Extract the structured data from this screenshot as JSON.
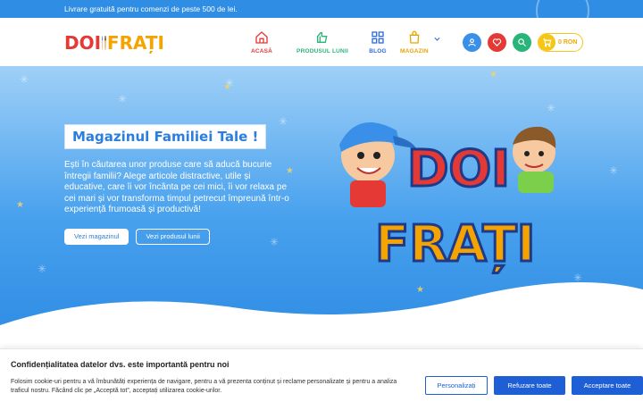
{
  "topbar": {
    "text": "Livrare gratuită pentru comenzi de peste 500 de lei."
  },
  "logo": {
    "text_part1": "DOI",
    "text_part2": "FRAȚI"
  },
  "nav": {
    "items": [
      {
        "label": "ACASĂ",
        "icon": "home-icon"
      },
      {
        "label": "PRODUSUL LUNII",
        "icon": "product-icon"
      },
      {
        "label": "BLOG",
        "icon": "grid-icon"
      },
      {
        "label": "MAGAZIN",
        "icon": "shopping-bag-icon"
      }
    ]
  },
  "header_actions": {
    "account_icon": "user-icon",
    "wishlist_icon": "heart-icon",
    "search_icon": "search-icon",
    "cart_icon": "cart-icon",
    "cart_total": "0 RON"
  },
  "hero": {
    "title": "Magazinul Familiei Tale !",
    "text": "Ești în căutarea unor produse care să aducă bucurie întregii familii? Alege articole distractive, utile și educative, care îi vor încânta pe cei mici, îi vor relaxa pe cei mari și vor transforma timpul petrecut împreună într-o experiență frumoasă și productivă!",
    "button_primary": "Vezi magazinul",
    "button_secondary": "Vezi produsul lunii",
    "brand_line1": "DOI",
    "brand_line2": "FRAȚI"
  },
  "cookie": {
    "title": "Confidențialitatea datelor dvs. este importantă pentru noi",
    "text": "Folosim cookie-uri pentru a vă îmbunătăți experiența de navigare, pentru a vă prezenta conținut și reclame personalizate și pentru a analiza traficul nostru. Făcând clic pe „Acceptă tot”, acceptați utilizarea cookie-urilor.",
    "btn_customize": "Personalizați",
    "btn_reject": "Refuzare toate",
    "btn_accept": "Acceptare toate"
  },
  "colors": {
    "brand_blue": "#2f8de4",
    "accent_red": "#e53935",
    "accent_yellow": "#f5c518",
    "accent_green": "#29b57a",
    "button_blue": "#1f5fd6"
  }
}
